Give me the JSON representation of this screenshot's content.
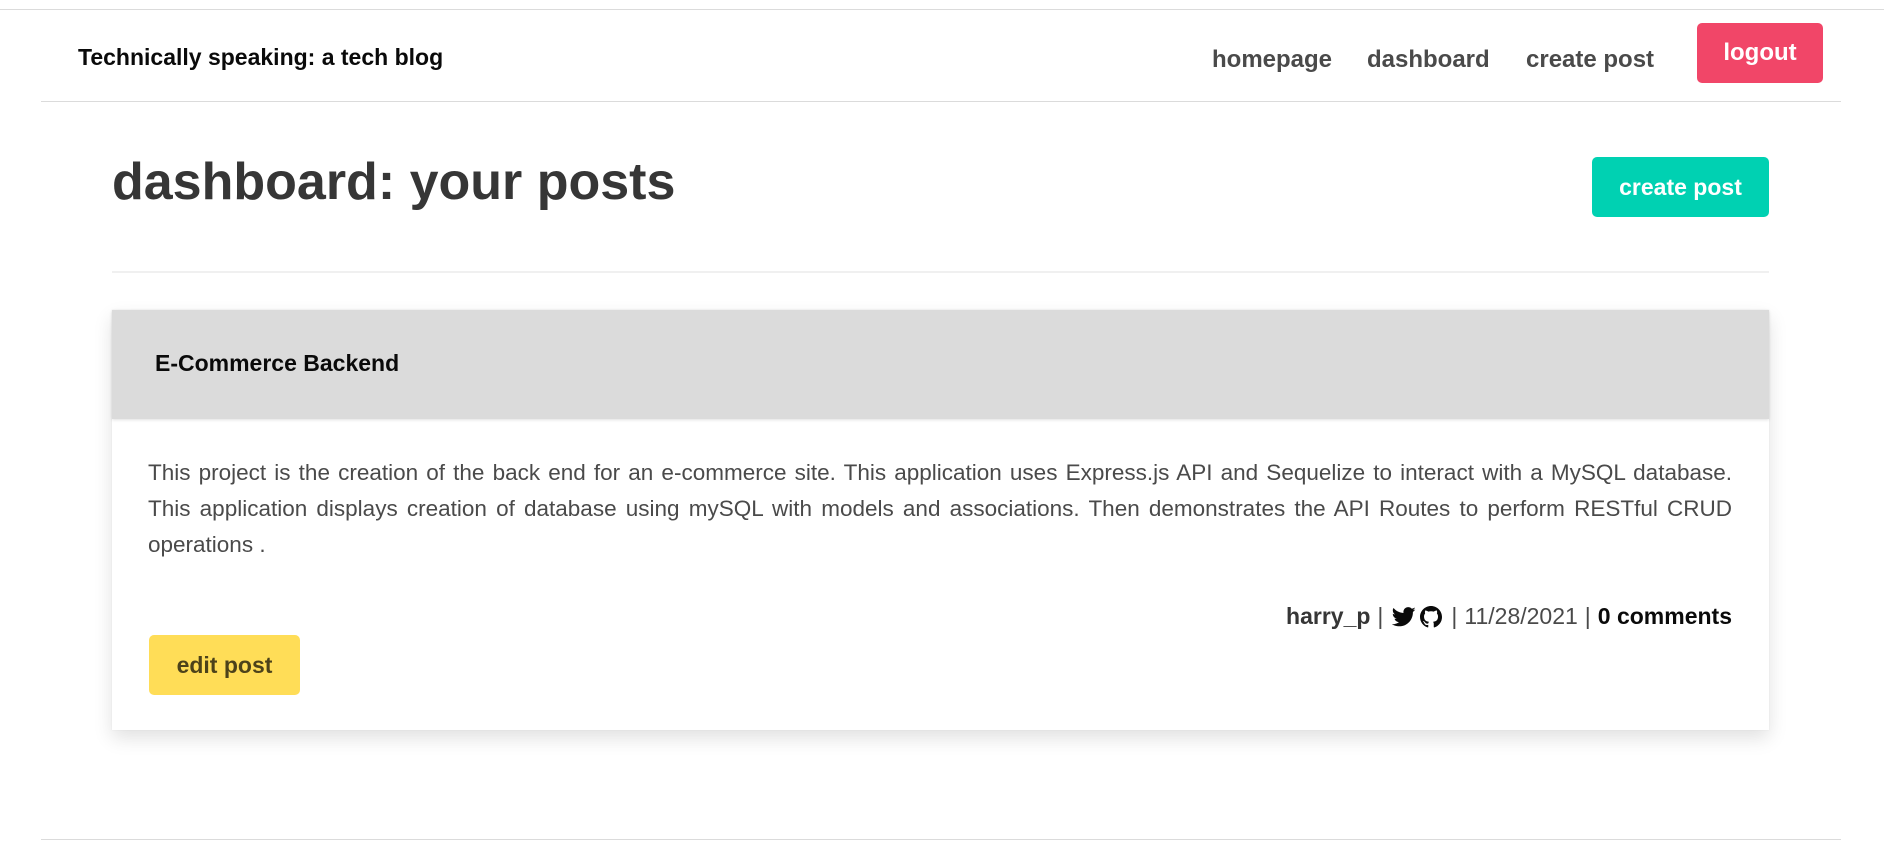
{
  "nav": {
    "brand": "Technically speaking: a tech blog",
    "links": {
      "homepage": "homepage",
      "dashboard": "dashboard",
      "create_post": "create post"
    },
    "logout": "logout"
  },
  "main": {
    "title": "dashboard: your posts",
    "create_button": "create post"
  },
  "post": {
    "title": "E-Commerce Backend",
    "body": "This project is the creation of the back end for an e-commerce site. This application uses Express.js API and Sequelize to interact with a MySQL database. This application displays creation of database using mySQL with models and associations. Then demonstrates the API Routes to perform RESTful CRUD operations .",
    "author": "harry_p",
    "separator": "|",
    "date": "11/28/2021",
    "comments": "0 comments",
    "icons": [
      "twitter-icon",
      "github-icon"
    ],
    "edit_button": "edit post"
  },
  "colors": {
    "logout": "#f14668",
    "create": "#00d1b2",
    "edit": "#ffdd57",
    "card_header": "#dbdbdb"
  }
}
